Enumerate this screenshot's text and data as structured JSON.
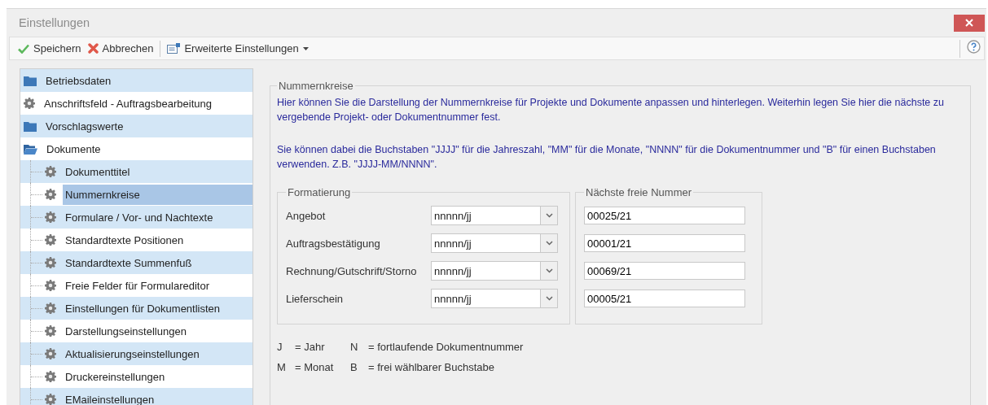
{
  "window": {
    "title": "Einstellungen"
  },
  "toolbar": {
    "items": [
      {
        "kind": "save",
        "label": "Speichern"
      },
      {
        "kind": "cancel",
        "label": "Abbrechen"
      },
      {
        "kind": "menu",
        "label": "Erweiterte Einstellungen"
      }
    ]
  },
  "sidebar": {
    "items": [
      {
        "kind": "folder",
        "label": "Betriebsdaten",
        "selected": false,
        "expanded": false
      },
      {
        "kind": "setting",
        "label": "Anschriftsfeld - Auftragsbearbeitung",
        "selected": false
      },
      {
        "kind": "folder",
        "label": "Vorschlagswerte",
        "selected": false,
        "expanded": false
      },
      {
        "kind": "folder",
        "label": "Dokumente",
        "selected": false,
        "expanded": true,
        "children": [
          {
            "kind": "setting",
            "label": "Dokumenttitel",
            "selected": false
          },
          {
            "kind": "setting",
            "label": "Nummernkreise",
            "selected": true
          },
          {
            "kind": "setting",
            "label": "Formulare / Vor- und Nachtexte",
            "selected": false
          },
          {
            "kind": "setting",
            "label": "Standardtexte Positionen",
            "selected": false
          },
          {
            "kind": "setting",
            "label": "Standardtexte Summenfuß",
            "selected": false
          },
          {
            "kind": "setting",
            "label": "Freie Felder für Formulareditor",
            "selected": false
          },
          {
            "kind": "setting",
            "label": "Einstellungen für Dokumentlisten",
            "selected": false
          },
          {
            "kind": "setting",
            "label": "Darstellungseinstellungen",
            "selected": false
          },
          {
            "kind": "setting",
            "label": "Aktualisierungseinstellungen",
            "selected": false
          },
          {
            "kind": "setting",
            "label": "Druckereinstellungen",
            "selected": false
          },
          {
            "kind": "setting",
            "label": "EMaileinstellungen",
            "selected": false
          }
        ]
      }
    ]
  },
  "panel": {
    "title": "Nummernkreise",
    "paragraphs": [
      "Hier können Sie die Darstellung der Nummernkreise für Projekte und Dokumente anpassen und hinterlegen. Weiterhin legen Sie hier die nächste zu vergebende Projekt- oder Dokumentnummer fest.",
      "Sie können dabei die Buchstaben \"JJJJ\" für die Jahreszahl, \"MM\" für die Monate, \"NNNN\" für die Dokumentnummer und \"B\" für einen Buchstaben verwenden. Z.B. \"JJJJ-MM/NNNN\"."
    ],
    "format_title": "Formatierung",
    "next_title": "Nächste freie Nummer",
    "rows": [
      {
        "label": "Angebot",
        "format": "nnnnn/jj",
        "next": "00025/21"
      },
      {
        "label": "Auftragsbestätigung",
        "format": "nnnnn/jj",
        "next": "00001/21"
      },
      {
        "label": "Rechnung/Gutschrift/Storno",
        "format": "nnnnn/jj",
        "next": "00069/21"
      },
      {
        "label": "Lieferschein",
        "format": "nnnnn/jj",
        "next": "00005/21"
      }
    ],
    "legend": [
      {
        "key": "J",
        "meaning": "= Jahr"
      },
      {
        "key": "N",
        "meaning": "= fortlaufende Dokumentnummer"
      },
      {
        "key": "M",
        "meaning": "= Monat"
      },
      {
        "key": "B",
        "meaning": "= frei wählbarer Buchstabe"
      }
    ]
  }
}
